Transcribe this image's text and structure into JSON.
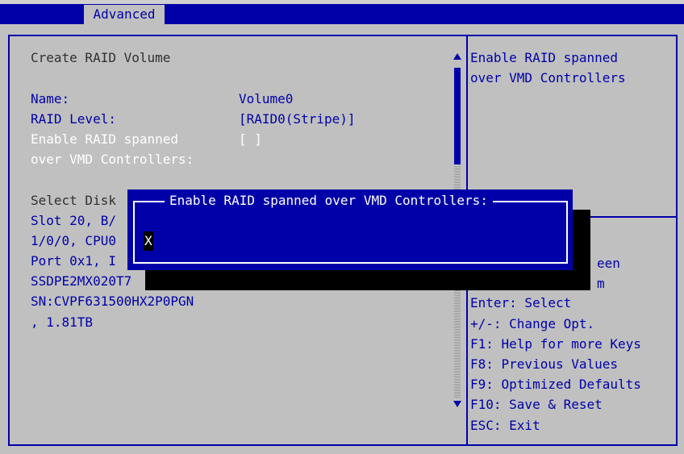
{
  "tabs": {
    "advanced": "Advanced"
  },
  "main": {
    "heading": "Create RAID Volume",
    "name_label": "Name:",
    "name_value": "Volume0",
    "raid_level_label": "RAID Level:",
    "raid_level_value": "[RAID0(Stripe)]",
    "span_label_1": "Enable RAID spanned",
    "span_label_2": "over VMD Controllers:",
    "span_value": "[ ]",
    "select_disk_partial": "Select Disk",
    "disk_line_1": "Slot 20, B/",
    "disk_line_2": "1/0/0, CPU0",
    "disk_line_3": "Port 0x1, I",
    "disk_line_4": "SSDPE2MX020T7",
    "disk_line_5": "SN:CVPF631500HX2P0PGN",
    "disk_line_6": ", 1.81TB"
  },
  "help": {
    "line_1": "Enable RAID spanned",
    "line_2": "over VMD Controllers"
  },
  "keys": {
    "partial_1": "een",
    "partial_2": "m",
    "enter": "Enter: Select",
    "change": "+/-: Change Opt.",
    "f1": "F1: Help for more Keys",
    "f8": "F8: Previous Values",
    "f9": "F9: Optimized Defaults",
    "f10": "F10: Save & Reset",
    "esc": "ESC: Exit"
  },
  "dialog": {
    "title": "Enable RAID spanned over VMD Controllers:",
    "input_value": "X"
  },
  "colors": {
    "bios_blue": "#0000a8",
    "background_gray": "#c0c0c0",
    "text_dark": "#303030",
    "highlight_white": "#ffffff"
  }
}
